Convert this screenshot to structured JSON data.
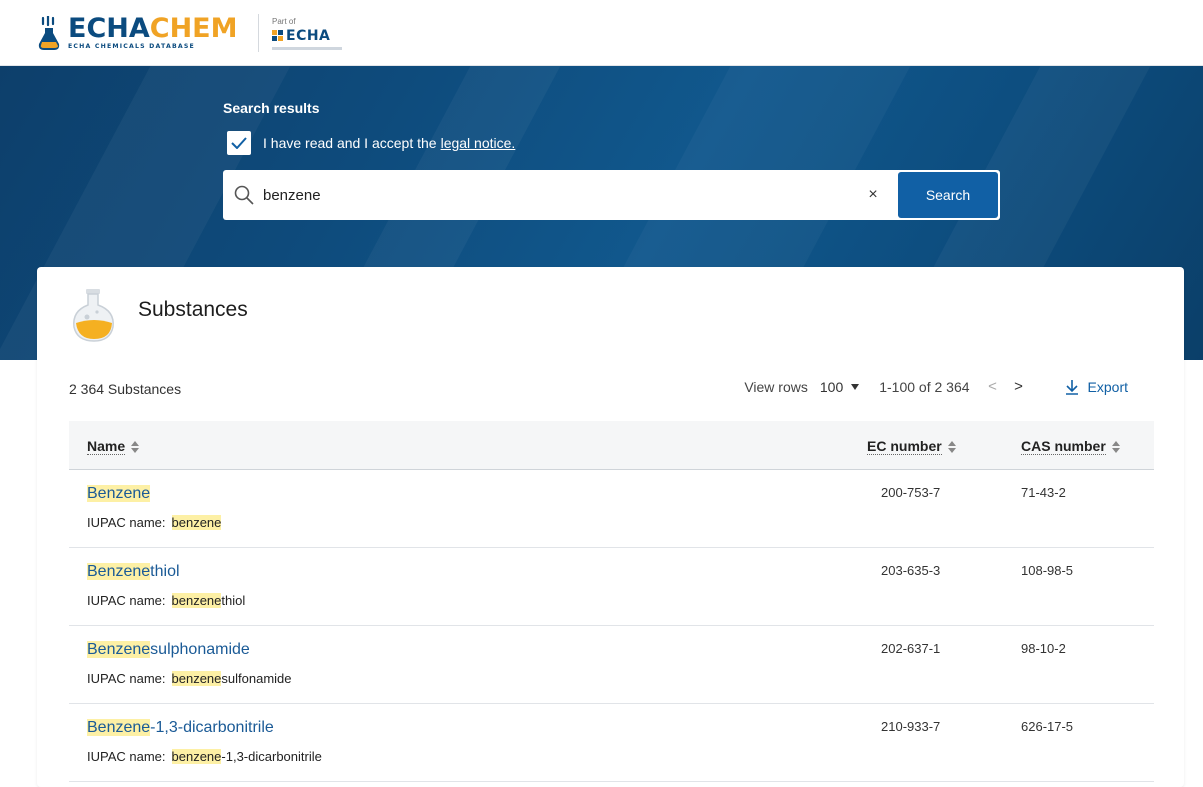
{
  "header": {
    "logo_echa": "ECHA",
    "logo_chem": "CHEM",
    "logo_sub": "ECHA CHEMICALS DATABASE",
    "part_of": "Part of",
    "part_of_logo": "ECHA"
  },
  "hero": {
    "title": "Search results",
    "legal_text": "I have read and I accept the",
    "legal_link": "legal notice.",
    "legal_checked": true,
    "search_value": "benzene",
    "clear_label": "×",
    "search_button": "Search"
  },
  "substances": {
    "title": "Substances",
    "count": "2 364 Substances",
    "view_rows_label": "View rows",
    "rows_value": "100",
    "range": "1-100 of 2 364",
    "prev": "<",
    "next": ">",
    "export": "Export",
    "columns": {
      "name": "Name",
      "ec": "EC number",
      "cas": "CAS number"
    },
    "rows": [
      {
        "name_hl": "Benzene",
        "name_rest": "",
        "iupac_label": "IUPAC name:",
        "iupac_hl": "benzene",
        "iupac_rest": "",
        "ec": "200-753-7",
        "cas": "71-43-2"
      },
      {
        "name_hl": "Benzene",
        "name_rest": "thiol",
        "iupac_label": "IUPAC name:",
        "iupac_hl": "benzene",
        "iupac_rest": "thiol",
        "ec": "203-635-3",
        "cas": "108-98-5"
      },
      {
        "name_hl": "Benzene",
        "name_rest": "sulphonamide",
        "iupac_label": "IUPAC name:",
        "iupac_hl": "benzene",
        "iupac_rest": "sulfonamide",
        "ec": "202-637-1",
        "cas": "98-10-2"
      },
      {
        "name_hl": "Benzene",
        "name_rest": "-1,3-dicarbonitrile",
        "iupac_label": "IUPAC name:",
        "iupac_hl": "benzene",
        "iupac_rest": "-1,3-dicarbonitrile",
        "ec": "210-933-7",
        "cas": "626-17-5"
      }
    ]
  },
  "colors": {
    "brand_blue": "#0b4b7f",
    "brand_orange": "#f0a325",
    "button_blue": "#1160a5",
    "highlight": "#fdf0a5"
  }
}
